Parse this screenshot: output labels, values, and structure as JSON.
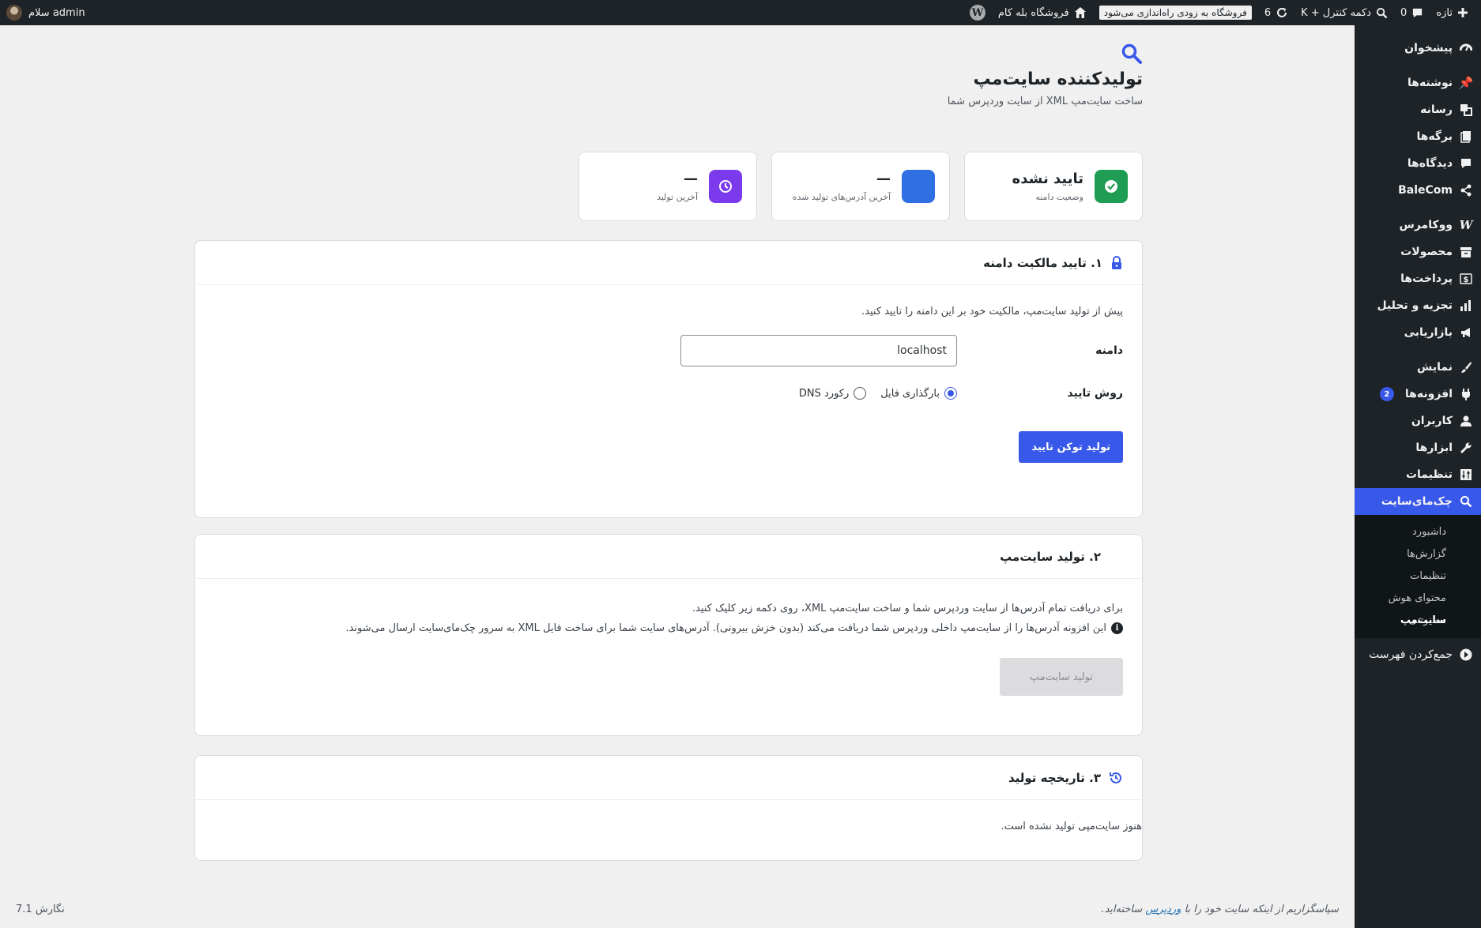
{
  "adminbar": {
    "site_name": "فروشگاه بله کام",
    "notice": "فروشگاه به زودی راه‌اندازی می‌شود",
    "updates_count": "6",
    "search_label": "دکمه کنترل + K",
    "comments_count": "0",
    "new_label": "تازه",
    "greeting": "سلام admin"
  },
  "sidebar": {
    "dashboard": "پیشخوان",
    "posts": "نوشته‌ها",
    "media": "رسانه",
    "pages": "برگه‌ها",
    "comments": "دیدگاه‌ها",
    "balecom": "BaleCom",
    "woocommerce": "ووکامرس",
    "products": "محصولات",
    "payments": "پرداخت‌ها",
    "analytics": "تجزیه و تحلیل",
    "marketing": "بازاریابی",
    "appearance": "نمایش",
    "plugins": "افزونه‌ها",
    "plugins_badge": "2",
    "users": "کاربران",
    "tools": "ابزارها",
    "settings": "تنظیمات",
    "sitecheck": "چک‌مای‌سایت",
    "submenu": {
      "dashboard": "داشبورد",
      "reports": "گزارش‌ها",
      "settings": "تنظیمات",
      "ai_content": "محتوای هوش مصنوعی",
      "sitemap": "سایت‌مپ"
    },
    "collapse": "جمع‌کردن فهرست"
  },
  "header": {
    "title": "تولیدکننده سایت‌مپ",
    "subtitle": "ساخت سایت‌مپ XML از سایت وردپرس شما"
  },
  "stats": {
    "domain_status_value": "تایید نشده",
    "domain_status_label": "وضعیت دامنه",
    "last_urls_value": "—",
    "last_urls_label": "آخرین آدرس‌های تولید شده",
    "last_generation_value": "—",
    "last_generation_label": "آخرین تولید",
    "colors": {
      "success": "#1f9d55",
      "blue": "#2f6fe4",
      "purple": "#7c3aed"
    }
  },
  "verify": {
    "title": "۱. تایید مالکیت دامنه",
    "description": "پیش از تولید سایت‌مپ، مالکیت خود بر این دامنه را تایید کنید.",
    "domain_label": "دامنه",
    "domain_value": "localhost",
    "method_label": "روش تایید",
    "method_file": "بارگذاری فایل",
    "method_dns": "رکورد DNS",
    "button": "تولید توکن تایید"
  },
  "generate": {
    "title": "۲. تولید سایت‌مپ",
    "line1": "برای دریافت تمام آدرس‌ها از سایت وردپرس شما و ساخت سایت‌مپ XML، روی دکمه زیر کلیک کنید.",
    "line2": "این افزونه آدرس‌ها را از سایت‌مپ داخلی وردپرس شما دریافت می‌کند (بدون خزش بیرونی). آدرس‌های سایت شما برای ساخت فایل XML به سرور چک‌مای‌سایت ارسال می‌شوند.",
    "button": "تولید سایت‌مپ"
  },
  "history": {
    "title": "۳. تاریخچه تولید",
    "empty": "هنوز سایت‌مپی تولید نشده است."
  },
  "footer": {
    "thanks_prefix": "سپاسگزاریم از اینکه سایت خود را با",
    "thanks_link": "وردپرس",
    "thanks_suffix": "ساخته‌اید.",
    "version": "نگارش 7.1"
  },
  "accent": "#3858e9"
}
